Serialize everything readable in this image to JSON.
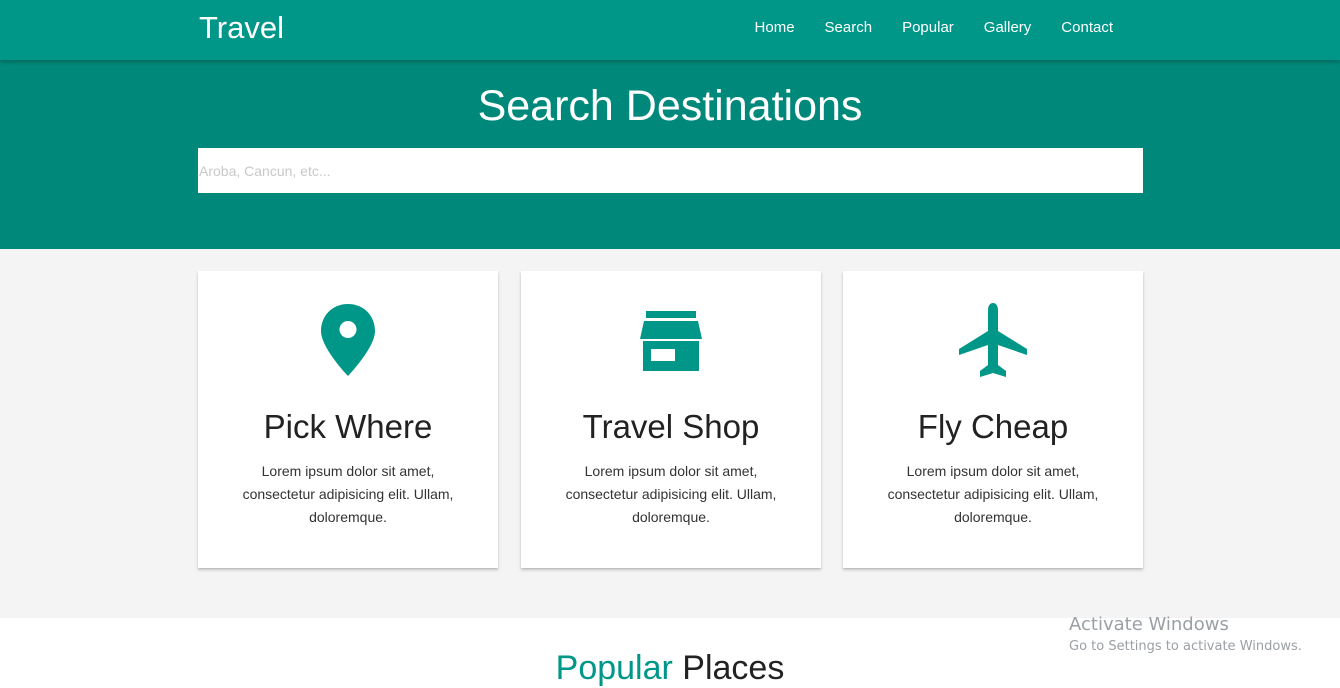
{
  "navbar": {
    "brand": "Travel",
    "links": [
      "Home",
      "Search",
      "Popular",
      "Gallery",
      "Contact"
    ]
  },
  "hero": {
    "title": "Search Destinations",
    "search_placeholder": "Aroba, Cancun, etc..."
  },
  "features": [
    {
      "icon": "map-marker-icon",
      "title": "Pick Where",
      "text": "Lorem ipsum dolor sit amet, consectetur adipisicing elit. Ullam, doloremque."
    },
    {
      "icon": "store-icon",
      "title": "Travel Shop",
      "text": "Lorem ipsum dolor sit amet, consectetur adipisicing elit. Ullam, doloremque."
    },
    {
      "icon": "airplane-icon",
      "title": "Fly Cheap",
      "text": "Lorem ipsum dolor sit amet, consectetur adipisicing elit. Ullam, doloremque."
    }
  ],
  "popular": {
    "title_accent": "Popular",
    "title_rest": " Places"
  },
  "watermark": {
    "line1": "Activate Windows",
    "line2": "Go to Settings to activate Windows."
  },
  "colors": {
    "nav": "#009688",
    "hero": "#00897b",
    "accent": "#009688",
    "section_bg": "#f4f4f4"
  }
}
